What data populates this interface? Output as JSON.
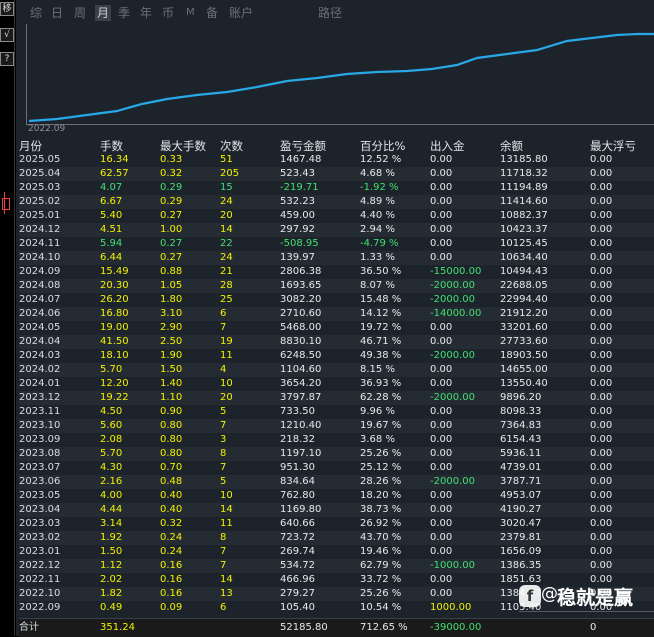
{
  "toolbar": {
    "buttons": [
      "移",
      "√",
      "?"
    ]
  },
  "tabs": [
    {
      "label": "综",
      "active": false
    },
    {
      "label": "日",
      "active": false
    },
    {
      "label": "周",
      "active": false
    },
    {
      "label": "月",
      "active": true
    },
    {
      "label": "季",
      "active": false
    },
    {
      "label": "年",
      "active": false
    },
    {
      "label": "币",
      "active": false
    },
    {
      "label": "M",
      "active": false
    },
    {
      "label": "备",
      "active": false
    },
    {
      "label": "账户",
      "active": false
    },
    {
      "label": "路径",
      "active": false
    }
  ],
  "chart": {
    "date_label": "2022.09",
    "line_color": "#29a8e8"
  },
  "table": {
    "headers": [
      "月份",
      "手数",
      "最大手数",
      "次数",
      "盈亏金额",
      "百分比%",
      "出入金",
      "余额",
      "最大浮亏"
    ],
    "rows": [
      {
        "month": "2025.05",
        "lots": "16.34",
        "max_lots": "0.33",
        "count": "51",
        "pnl": "1467.48",
        "pct": "12.52 %",
        "flow": "0.00",
        "balance": "13185.80",
        "max_float": "0.00",
        "hl": ""
      },
      {
        "month": "2025.04",
        "lots": "62.57",
        "max_lots": "0.32",
        "count": "205",
        "pnl": "523.43",
        "pct": "4.68 %",
        "flow": "0.00",
        "balance": "11718.32",
        "max_float": "0.00",
        "hl": ""
      },
      {
        "month": "2025.03",
        "lots": "4.07",
        "max_lots": "0.29",
        "count": "15",
        "pnl": "-219.71",
        "pct": "-1.92 %",
        "flow": "0.00",
        "balance": "11194.89",
        "max_float": "0.00",
        "hl": "loss"
      },
      {
        "month": "2025.02",
        "lots": "6.67",
        "max_lots": "0.29",
        "count": "24",
        "pnl": "532.23",
        "pct": "4.89 %",
        "flow": "0.00",
        "balance": "11414.60",
        "max_float": "0.00",
        "hl": ""
      },
      {
        "month": "2025.01",
        "lots": "5.40",
        "max_lots": "0.27",
        "count": "20",
        "pnl": "459.00",
        "pct": "4.40 %",
        "flow": "0.00",
        "balance": "10882.37",
        "max_float": "0.00",
        "hl": ""
      },
      {
        "month": "2024.12",
        "lots": "4.51",
        "max_lots": "1.00",
        "count": "14",
        "pnl": "297.92",
        "pct": "2.94 %",
        "flow": "0.00",
        "balance": "10423.37",
        "max_float": "0.00",
        "hl": ""
      },
      {
        "month": "2024.11",
        "lots": "5.94",
        "max_lots": "0.27",
        "count": "22",
        "pnl": "-508.95",
        "pct": "-4.79 %",
        "flow": "0.00",
        "balance": "10125.45",
        "max_float": "0.00",
        "hl": "loss"
      },
      {
        "month": "2024.10",
        "lots": "6.44",
        "max_lots": "0.27",
        "count": "24",
        "pnl": "139.97",
        "pct": "1.33 %",
        "flow": "0.00",
        "balance": "10634.40",
        "max_float": "0.00",
        "hl": ""
      },
      {
        "month": "2024.09",
        "lots": "15.49",
        "max_lots": "0.88",
        "count": "21",
        "pnl": "2806.38",
        "pct": "36.50 %",
        "flow": "-15000.00",
        "balance": "10494.43",
        "max_float": "0.00",
        "hl": "out"
      },
      {
        "month": "2024.08",
        "lots": "20.30",
        "max_lots": "1.05",
        "count": "28",
        "pnl": "1693.65",
        "pct": "8.07 %",
        "flow": "-2000.00",
        "balance": "22688.05",
        "max_float": "0.00",
        "hl": "out"
      },
      {
        "month": "2024.07",
        "lots": "26.20",
        "max_lots": "1.80",
        "count": "25",
        "pnl": "3082.20",
        "pct": "15.48 %",
        "flow": "-2000.00",
        "balance": "22994.40",
        "max_float": "0.00",
        "hl": "out"
      },
      {
        "month": "2024.06",
        "lots": "16.80",
        "max_lots": "3.10",
        "count": "6",
        "pnl": "2710.60",
        "pct": "14.12 %",
        "flow": "-14000.00",
        "balance": "21912.20",
        "max_float": "0.00",
        "hl": "out"
      },
      {
        "month": "2024.05",
        "lots": "19.00",
        "max_lots": "2.90",
        "count": "7",
        "pnl": "5468.00",
        "pct": "19.72 %",
        "flow": "0.00",
        "balance": "33201.60",
        "max_float": "0.00",
        "hl": ""
      },
      {
        "month": "2024.04",
        "lots": "41.50",
        "max_lots": "2.50",
        "count": "19",
        "pnl": "8830.10",
        "pct": "46.71 %",
        "flow": "0.00",
        "balance": "27733.60",
        "max_float": "0.00",
        "hl": ""
      },
      {
        "month": "2024.03",
        "lots": "18.10",
        "max_lots": "1.90",
        "count": "11",
        "pnl": "6248.50",
        "pct": "49.38 %",
        "flow": "-2000.00",
        "balance": "18903.50",
        "max_float": "0.00",
        "hl": "out"
      },
      {
        "month": "2024.02",
        "lots": "5.70",
        "max_lots": "1.50",
        "count": "4",
        "pnl": "1104.60",
        "pct": "8.15 %",
        "flow": "0.00",
        "balance": "14655.00",
        "max_float": "0.00",
        "hl": ""
      },
      {
        "month": "2024.01",
        "lots": "12.20",
        "max_lots": "1.40",
        "count": "10",
        "pnl": "3654.20",
        "pct": "36.93 %",
        "flow": "0.00",
        "balance": "13550.40",
        "max_float": "0.00",
        "hl": ""
      },
      {
        "month": "2023.12",
        "lots": "19.22",
        "max_lots": "1.10",
        "count": "20",
        "pnl": "3797.87",
        "pct": "62.28 %",
        "flow": "-2000.00",
        "balance": "9896.20",
        "max_float": "0.00",
        "hl": "out"
      },
      {
        "month": "2023.11",
        "lots": "4.50",
        "max_lots": "0.90",
        "count": "5",
        "pnl": "733.50",
        "pct": "9.96 %",
        "flow": "0.00",
        "balance": "8098.33",
        "max_float": "0.00",
        "hl": ""
      },
      {
        "month": "2023.10",
        "lots": "5.60",
        "max_lots": "0.80",
        "count": "7",
        "pnl": "1210.40",
        "pct": "19.67 %",
        "flow": "0.00",
        "balance": "7364.83",
        "max_float": "0.00",
        "hl": ""
      },
      {
        "month": "2023.09",
        "lots": "2.08",
        "max_lots": "0.80",
        "count": "3",
        "pnl": "218.32",
        "pct": "3.68 %",
        "flow": "0.00",
        "balance": "6154.43",
        "max_float": "0.00",
        "hl": ""
      },
      {
        "month": "2023.08",
        "lots": "5.70",
        "max_lots": "0.80",
        "count": "8",
        "pnl": "1197.10",
        "pct": "25.26 %",
        "flow": "0.00",
        "balance": "5936.11",
        "max_float": "0.00",
        "hl": ""
      },
      {
        "month": "2023.07",
        "lots": "4.30",
        "max_lots": "0.70",
        "count": "7",
        "pnl": "951.30",
        "pct": "25.12 %",
        "flow": "0.00",
        "balance": "4739.01",
        "max_float": "0.00",
        "hl": ""
      },
      {
        "month": "2023.06",
        "lots": "2.16",
        "max_lots": "0.48",
        "count": "5",
        "pnl": "834.64",
        "pct": "28.26 %",
        "flow": "-2000.00",
        "balance": "3787.71",
        "max_float": "0.00",
        "hl": "out"
      },
      {
        "month": "2023.05",
        "lots": "4.00",
        "max_lots": "0.40",
        "count": "10",
        "pnl": "762.80",
        "pct": "18.20 %",
        "flow": "0.00",
        "balance": "4953.07",
        "max_float": "0.00",
        "hl": ""
      },
      {
        "month": "2023.04",
        "lots": "4.44",
        "max_lots": "0.40",
        "count": "14",
        "pnl": "1169.80",
        "pct": "38.73 %",
        "flow": "0.00",
        "balance": "4190.27",
        "max_float": "0.00",
        "hl": ""
      },
      {
        "month": "2023.03",
        "lots": "3.14",
        "max_lots": "0.32",
        "count": "11",
        "pnl": "640.66",
        "pct": "26.92 %",
        "flow": "0.00",
        "balance": "3020.47",
        "max_float": "0.00",
        "hl": ""
      },
      {
        "month": "2023.02",
        "lots": "1.92",
        "max_lots": "0.24",
        "count": "8",
        "pnl": "723.72",
        "pct": "43.70 %",
        "flow": "0.00",
        "balance": "2379.81",
        "max_float": "0.00",
        "hl": ""
      },
      {
        "month": "2023.01",
        "lots": "1.50",
        "max_lots": "0.24",
        "count": "7",
        "pnl": "269.74",
        "pct": "19.46 %",
        "flow": "0.00",
        "balance": "1656.09",
        "max_float": "0.00",
        "hl": ""
      },
      {
        "month": "2022.12",
        "lots": "1.12",
        "max_lots": "0.16",
        "count": "7",
        "pnl": "534.72",
        "pct": "62.79 %",
        "flow": "-1000.00",
        "balance": "1386.35",
        "max_float": "0.00",
        "hl": "out"
      },
      {
        "month": "2022.11",
        "lots": "2.02",
        "max_lots": "0.16",
        "count": "14",
        "pnl": "466.96",
        "pct": "33.72 %",
        "flow": "0.00",
        "balance": "1851.63",
        "max_float": "0.00",
        "hl": ""
      },
      {
        "month": "2022.10",
        "lots": "1.82",
        "max_lots": "0.16",
        "count": "13",
        "pnl": "279.27",
        "pct": "25.26 %",
        "flow": "0.00",
        "balance": "1384.67",
        "max_float": "0.00",
        "hl": ""
      },
      {
        "month": "2022.09",
        "lots": "0.49",
        "max_lots": "0.09",
        "count": "6",
        "pnl": "105.40",
        "pct": "10.54 %",
        "flow": "1000.00",
        "balance": "1105.40",
        "max_float": "0.00",
        "hl": "in"
      }
    ],
    "total": {
      "month": "合计",
      "lots": "351.24",
      "max_lots": "",
      "count": "",
      "pnl": "52185.80",
      "pct": "712.65 %",
      "flow": "-39000.00",
      "balance": "",
      "max_float": "0"
    }
  },
  "watermark": {
    "logo": "f",
    "at": "@",
    "text": "稳就是赢"
  }
}
